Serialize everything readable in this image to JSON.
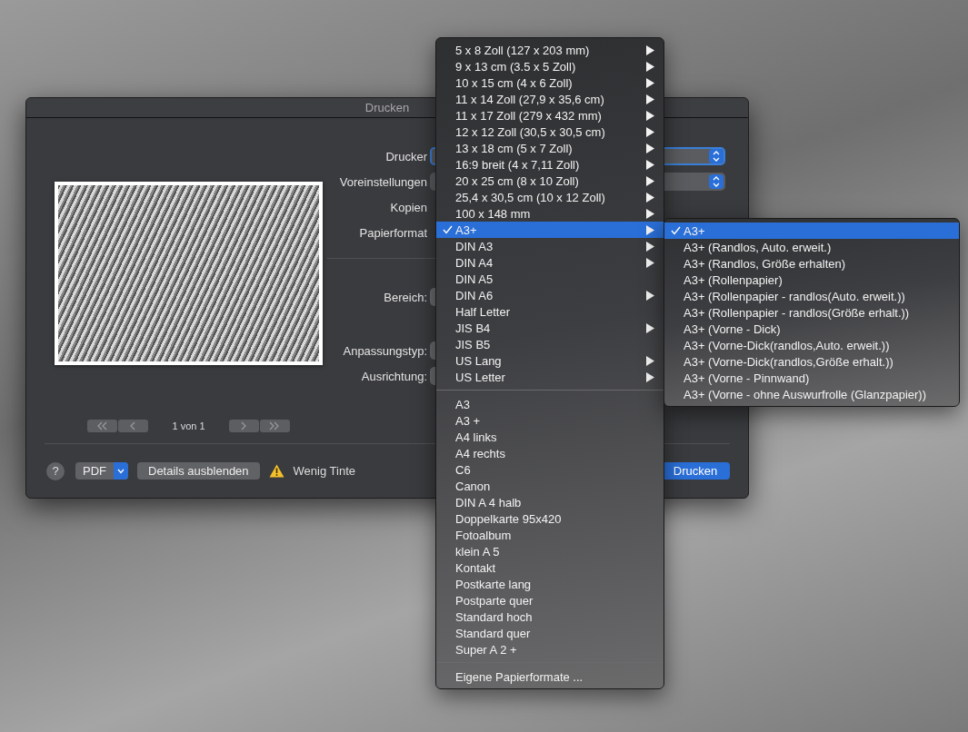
{
  "window": {
    "title": "Drucken"
  },
  "print_settings": [
    {
      "label": "Drucker",
      "kind": "popup",
      "focused": true
    },
    {
      "label": "Voreinstellungen",
      "kind": "popup",
      "focused": false
    },
    {
      "label": "Kopien",
      "kind": "none"
    },
    {
      "label": "Papierformat",
      "kind": "none"
    }
  ],
  "layout_settings": [
    {
      "label": "Bereich:",
      "kind": "control"
    },
    {
      "label": "Anpassungstyp:",
      "kind": "control"
    },
    {
      "label": "Ausrichtung:",
      "kind": "control"
    }
  ],
  "pager": {
    "text": "1 von 1"
  },
  "footer": {
    "help": "?",
    "pdf": "PDF",
    "details_button": "Details ausblenden",
    "warning": "Wenig Tinte",
    "print_button": "Drucken"
  },
  "paper_menu": {
    "sections": [
      [
        {
          "label": "5 x 8 Zoll (127 x 203 mm)",
          "submenu": true,
          "selected": false
        },
        {
          "label": "9 x 13 cm (3.5 x 5 Zoll)",
          "submenu": true,
          "selected": false
        },
        {
          "label": "10 x 15 cm (4 x 6 Zoll)",
          "submenu": true,
          "selected": false
        },
        {
          "label": "11 x 14 Zoll (27,9 x 35,6 cm)",
          "submenu": true,
          "selected": false
        },
        {
          "label": "11 x 17 Zoll (279 x 432 mm)",
          "submenu": true,
          "selected": false
        },
        {
          "label": "12 x 12 Zoll (30,5 x 30,5 cm)",
          "submenu": true,
          "selected": false
        },
        {
          "label": "13 x 18 cm (5 x 7 Zoll)",
          "submenu": true,
          "selected": false
        },
        {
          "label": "16:9 breit (4 x 7,11 Zoll)",
          "submenu": true,
          "selected": false
        },
        {
          "label": "20 x 25 cm (8 x 10 Zoll)",
          "submenu": true,
          "selected": false
        },
        {
          "label": "25,4 x 30,5 cm (10 x 12 Zoll)",
          "submenu": true,
          "selected": false
        },
        {
          "label": "100 x 148 mm",
          "submenu": true,
          "selected": false
        },
        {
          "label": "A3+",
          "submenu": true,
          "selected": true
        },
        {
          "label": "DIN A3",
          "submenu": true,
          "selected": false
        },
        {
          "label": "DIN A4",
          "submenu": true,
          "selected": false
        },
        {
          "label": "DIN A5",
          "submenu": false,
          "selected": false
        },
        {
          "label": "DIN A6",
          "submenu": true,
          "selected": false
        },
        {
          "label": "Half Letter",
          "submenu": false,
          "selected": false
        },
        {
          "label": "JIS B4",
          "submenu": true,
          "selected": false
        },
        {
          "label": "JIS B5",
          "submenu": false,
          "selected": false
        },
        {
          "label": "US Lang",
          "submenu": true,
          "selected": false
        },
        {
          "label": "US Letter",
          "submenu": true,
          "selected": false
        }
      ],
      [
        {
          "label": "A3",
          "submenu": false,
          "selected": false
        },
        {
          "label": "A3 +",
          "submenu": false,
          "selected": false
        },
        {
          "label": "A4 links",
          "submenu": false,
          "selected": false
        },
        {
          "label": "A4 rechts",
          "submenu": false,
          "selected": false
        },
        {
          "label": "C6",
          "submenu": false,
          "selected": false
        },
        {
          "label": "Canon",
          "submenu": false,
          "selected": false
        },
        {
          "label": "DIN A 4 halb",
          "submenu": false,
          "selected": false
        },
        {
          "label": "Doppelkarte 95x420",
          "submenu": false,
          "selected": false
        },
        {
          "label": "Fotoalbum",
          "submenu": false,
          "selected": false
        },
        {
          "label": "klein A 5",
          "submenu": false,
          "selected": false
        },
        {
          "label": "Kontakt",
          "submenu": false,
          "selected": false
        },
        {
          "label": "Postkarte lang",
          "submenu": false,
          "selected": false
        },
        {
          "label": "Postparte quer",
          "submenu": false,
          "selected": false
        },
        {
          "label": "Standard hoch",
          "submenu": false,
          "selected": false
        },
        {
          "label": "Standard quer",
          "submenu": false,
          "selected": false
        },
        {
          "label": "Super A 2 +",
          "submenu": false,
          "selected": false
        }
      ],
      [
        {
          "label": "Eigene Papierformate ...",
          "submenu": false,
          "selected": false
        }
      ]
    ]
  },
  "submenu": {
    "items": [
      {
        "label": "A3+",
        "selected": true
      },
      {
        "label": "A3+ (Randlos, Auto. erweit.)",
        "selected": false
      },
      {
        "label": "A3+ (Randlos, Größe erhalten)",
        "selected": false
      },
      {
        "label": "A3+ (Rollenpapier)",
        "selected": false
      },
      {
        "label": "A3+ (Rollenpapier - randlos(Auto. erweit.))",
        "selected": false
      },
      {
        "label": "A3+ (Rollenpapier - randlos(Größe erhalt.))",
        "selected": false
      },
      {
        "label": "A3+ (Vorne - Dick)",
        "selected": false
      },
      {
        "label": "A3+ (Vorne-Dick(randlos,Auto. erweit.))",
        "selected": false
      },
      {
        "label": "A3+ (Vorne-Dick(randlos,Größe erhalt.))",
        "selected": false
      },
      {
        "label": "A3+ (Vorne - Pinnwand)",
        "selected": false
      },
      {
        "label": "A3+ (Vorne - ohne Auswurfrolle (Glanzpapier))",
        "selected": false
      }
    ]
  }
}
